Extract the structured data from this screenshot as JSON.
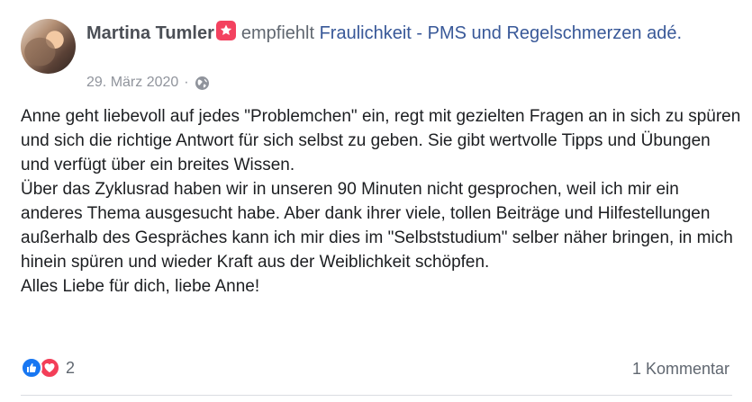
{
  "post": {
    "author": "Martina Tumler",
    "verb": "empfiehlt",
    "page_name": "Fraulichkeit - PMS und Regelschmerzen adé.",
    "date": "29. März 2020",
    "separator": "·",
    "privacy_icon": "globe-icon",
    "recommend_icon": "recommend-badge-icon",
    "body_lines": [
      "Anne geht liebevoll auf jedes \"Problemchen\" ein, regt mit gezielten Fragen an in sich zu spüren und sich die richtige Antwort für sich selbst zu geben. Sie gibt wertvolle Tipps und Übungen und verfügt über ein breites Wissen.",
      "Über das Zyklusrad haben wir in unseren 90 Minuten nicht gesprochen, weil ich mir ein anderes Thema ausgesucht habe. Aber dank ihrer viele, tollen Beiträge und Hilfestellungen außerhalb des Gespräches kann ich mir dies im \"Selbststudium\" selber näher bringen, in mich hinein spüren und wieder Kraft aus der Weiblichkeit schöpfen.",
      "Alles Liebe für dich, liebe Anne!"
    ],
    "reactions": {
      "icons": [
        "like-icon",
        "love-icon"
      ],
      "count": "2"
    },
    "comments_label": "1 Kommentar"
  },
  "colors": {
    "link": "#385898",
    "meta": "#90949c",
    "badge": "#f3425f",
    "like": "#1877f2",
    "love": "#f33e58"
  }
}
